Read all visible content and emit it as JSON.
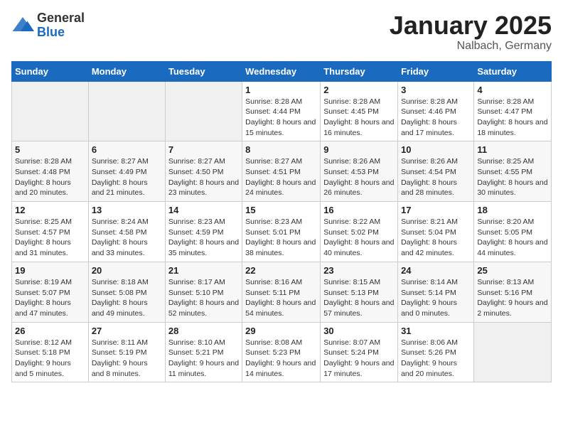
{
  "logo": {
    "general": "General",
    "blue": "Blue"
  },
  "title": "January 2025",
  "subtitle": "Nalbach, Germany",
  "days_header": [
    "Sunday",
    "Monday",
    "Tuesday",
    "Wednesday",
    "Thursday",
    "Friday",
    "Saturday"
  ],
  "weeks": [
    [
      {
        "day": "",
        "sunrise": "",
        "sunset": "",
        "daylight": ""
      },
      {
        "day": "",
        "sunrise": "",
        "sunset": "",
        "daylight": ""
      },
      {
        "day": "",
        "sunrise": "",
        "sunset": "",
        "daylight": ""
      },
      {
        "day": "1",
        "sunrise": "Sunrise: 8:28 AM",
        "sunset": "Sunset: 4:44 PM",
        "daylight": "Daylight: 8 hours and 15 minutes."
      },
      {
        "day": "2",
        "sunrise": "Sunrise: 8:28 AM",
        "sunset": "Sunset: 4:45 PM",
        "daylight": "Daylight: 8 hours and 16 minutes."
      },
      {
        "day": "3",
        "sunrise": "Sunrise: 8:28 AM",
        "sunset": "Sunset: 4:46 PM",
        "daylight": "Daylight: 8 hours and 17 minutes."
      },
      {
        "day": "4",
        "sunrise": "Sunrise: 8:28 AM",
        "sunset": "Sunset: 4:47 PM",
        "daylight": "Daylight: 8 hours and 18 minutes."
      }
    ],
    [
      {
        "day": "5",
        "sunrise": "Sunrise: 8:28 AM",
        "sunset": "Sunset: 4:48 PM",
        "daylight": "Daylight: 8 hours and 20 minutes."
      },
      {
        "day": "6",
        "sunrise": "Sunrise: 8:27 AM",
        "sunset": "Sunset: 4:49 PM",
        "daylight": "Daylight: 8 hours and 21 minutes."
      },
      {
        "day": "7",
        "sunrise": "Sunrise: 8:27 AM",
        "sunset": "Sunset: 4:50 PM",
        "daylight": "Daylight: 8 hours and 23 minutes."
      },
      {
        "day": "8",
        "sunrise": "Sunrise: 8:27 AM",
        "sunset": "Sunset: 4:51 PM",
        "daylight": "Daylight: 8 hours and 24 minutes."
      },
      {
        "day": "9",
        "sunrise": "Sunrise: 8:26 AM",
        "sunset": "Sunset: 4:53 PM",
        "daylight": "Daylight: 8 hours and 26 minutes."
      },
      {
        "day": "10",
        "sunrise": "Sunrise: 8:26 AM",
        "sunset": "Sunset: 4:54 PM",
        "daylight": "Daylight: 8 hours and 28 minutes."
      },
      {
        "day": "11",
        "sunrise": "Sunrise: 8:25 AM",
        "sunset": "Sunset: 4:55 PM",
        "daylight": "Daylight: 8 hours and 30 minutes."
      }
    ],
    [
      {
        "day": "12",
        "sunrise": "Sunrise: 8:25 AM",
        "sunset": "Sunset: 4:57 PM",
        "daylight": "Daylight: 8 hours and 31 minutes."
      },
      {
        "day": "13",
        "sunrise": "Sunrise: 8:24 AM",
        "sunset": "Sunset: 4:58 PM",
        "daylight": "Daylight: 8 hours and 33 minutes."
      },
      {
        "day": "14",
        "sunrise": "Sunrise: 8:23 AM",
        "sunset": "Sunset: 4:59 PM",
        "daylight": "Daylight: 8 hours and 35 minutes."
      },
      {
        "day": "15",
        "sunrise": "Sunrise: 8:23 AM",
        "sunset": "Sunset: 5:01 PM",
        "daylight": "Daylight: 8 hours and 38 minutes."
      },
      {
        "day": "16",
        "sunrise": "Sunrise: 8:22 AM",
        "sunset": "Sunset: 5:02 PM",
        "daylight": "Daylight: 8 hours and 40 minutes."
      },
      {
        "day": "17",
        "sunrise": "Sunrise: 8:21 AM",
        "sunset": "Sunset: 5:04 PM",
        "daylight": "Daylight: 8 hours and 42 minutes."
      },
      {
        "day": "18",
        "sunrise": "Sunrise: 8:20 AM",
        "sunset": "Sunset: 5:05 PM",
        "daylight": "Daylight: 8 hours and 44 minutes."
      }
    ],
    [
      {
        "day": "19",
        "sunrise": "Sunrise: 8:19 AM",
        "sunset": "Sunset: 5:07 PM",
        "daylight": "Daylight: 8 hours and 47 minutes."
      },
      {
        "day": "20",
        "sunrise": "Sunrise: 8:18 AM",
        "sunset": "Sunset: 5:08 PM",
        "daylight": "Daylight: 8 hours and 49 minutes."
      },
      {
        "day": "21",
        "sunrise": "Sunrise: 8:17 AM",
        "sunset": "Sunset: 5:10 PM",
        "daylight": "Daylight: 8 hours and 52 minutes."
      },
      {
        "day": "22",
        "sunrise": "Sunrise: 8:16 AM",
        "sunset": "Sunset: 5:11 PM",
        "daylight": "Daylight: 8 hours and 54 minutes."
      },
      {
        "day": "23",
        "sunrise": "Sunrise: 8:15 AM",
        "sunset": "Sunset: 5:13 PM",
        "daylight": "Daylight: 8 hours and 57 minutes."
      },
      {
        "day": "24",
        "sunrise": "Sunrise: 8:14 AM",
        "sunset": "Sunset: 5:14 PM",
        "daylight": "Daylight: 9 hours and 0 minutes."
      },
      {
        "day": "25",
        "sunrise": "Sunrise: 8:13 AM",
        "sunset": "Sunset: 5:16 PM",
        "daylight": "Daylight: 9 hours and 2 minutes."
      }
    ],
    [
      {
        "day": "26",
        "sunrise": "Sunrise: 8:12 AM",
        "sunset": "Sunset: 5:18 PM",
        "daylight": "Daylight: 9 hours and 5 minutes."
      },
      {
        "day": "27",
        "sunrise": "Sunrise: 8:11 AM",
        "sunset": "Sunset: 5:19 PM",
        "daylight": "Daylight: 9 hours and 8 minutes."
      },
      {
        "day": "28",
        "sunrise": "Sunrise: 8:10 AM",
        "sunset": "Sunset: 5:21 PM",
        "daylight": "Daylight: 9 hours and 11 minutes."
      },
      {
        "day": "29",
        "sunrise": "Sunrise: 8:08 AM",
        "sunset": "Sunset: 5:23 PM",
        "daylight": "Daylight: 9 hours and 14 minutes."
      },
      {
        "day": "30",
        "sunrise": "Sunrise: 8:07 AM",
        "sunset": "Sunset: 5:24 PM",
        "daylight": "Daylight: 9 hours and 17 minutes."
      },
      {
        "day": "31",
        "sunrise": "Sunrise: 8:06 AM",
        "sunset": "Sunset: 5:26 PM",
        "daylight": "Daylight: 9 hours and 20 minutes."
      },
      {
        "day": "",
        "sunrise": "",
        "sunset": "",
        "daylight": ""
      }
    ]
  ]
}
